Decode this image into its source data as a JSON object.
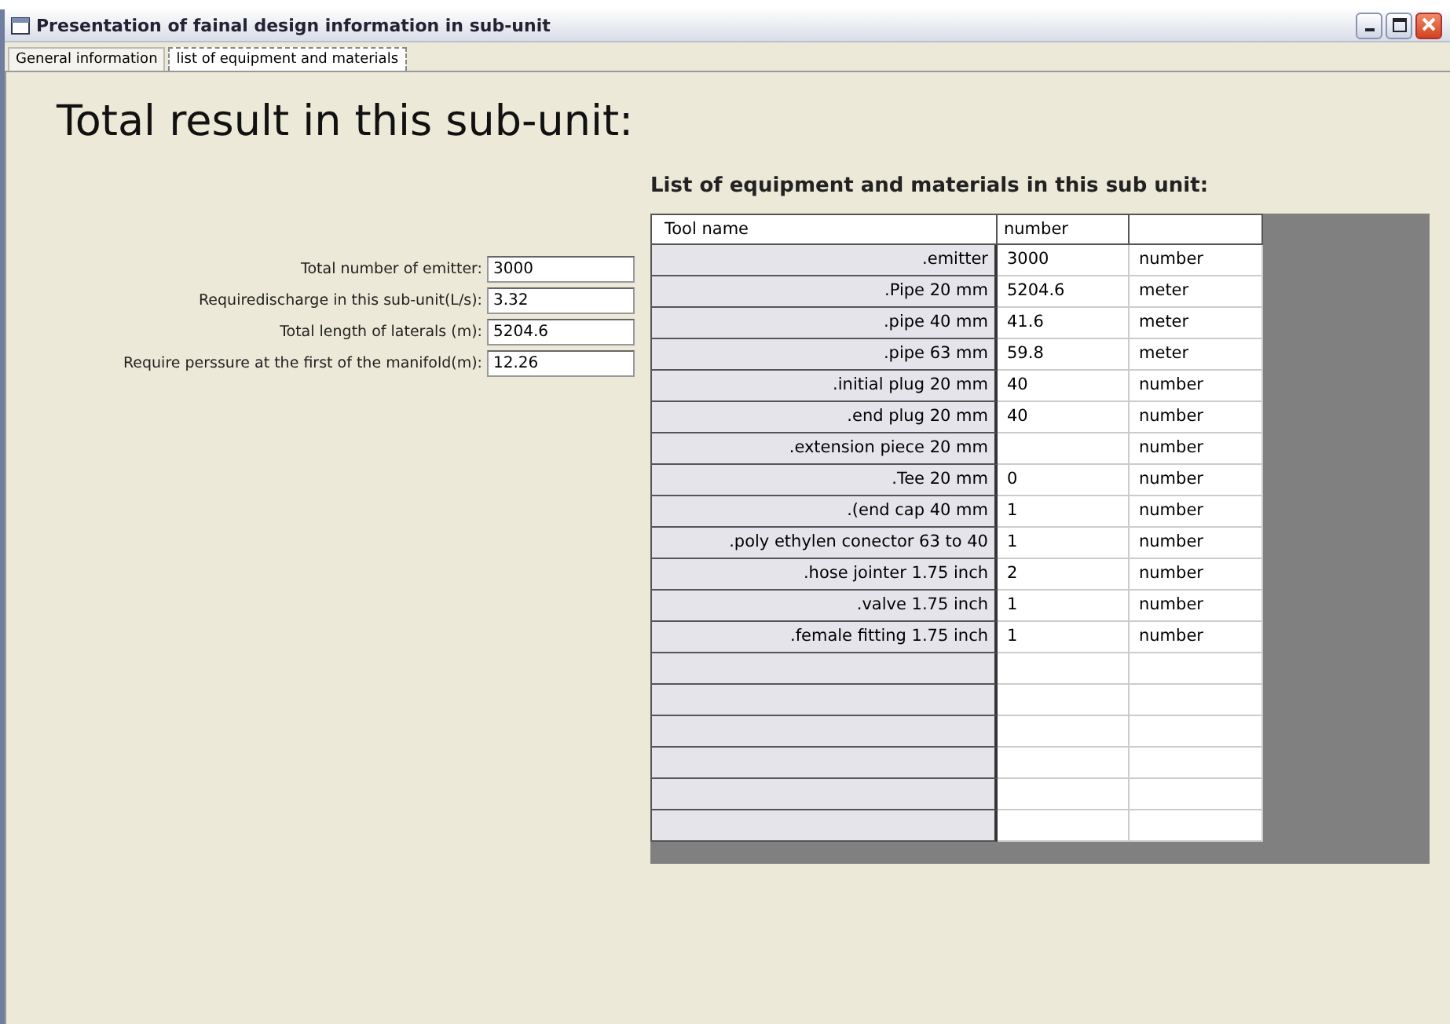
{
  "window": {
    "title": "Presentation of fainal design information in sub-unit"
  },
  "tabs": [
    {
      "label": "General information",
      "selected": false
    },
    {
      "label": "list of equipment and materials",
      "selected": true
    }
  ],
  "heading": "Total result in this sub-unit:",
  "fields": [
    {
      "label": "Total number of emitter:",
      "value": "3000"
    },
    {
      "label": "Requiredischarge in this sub-unit(L/s):",
      "value": "3.32"
    },
    {
      "label": "Total length of laterals (m):",
      "value": "5204.6"
    },
    {
      "label": "Require perssure at the first of the manifold(m):",
      "value": "12.26"
    }
  ],
  "table": {
    "title": "List of equipment and materials in this sub unit:",
    "columns": [
      "Tool name",
      "number"
    ],
    "rows": [
      {
        "name": ".emitter",
        "number": "3000",
        "unit": "number"
      },
      {
        "name": ".Pipe 20 mm",
        "number": "5204.6",
        "unit": "meter"
      },
      {
        "name": ".pipe 40 mm",
        "number": "41.6",
        "unit": "meter"
      },
      {
        "name": ".pipe 63 mm",
        "number": "59.8",
        "unit": "meter"
      },
      {
        "name": ".initial plug 20 mm",
        "number": "40",
        "unit": "number"
      },
      {
        "name": ".end plug 20 mm",
        "number": "40",
        "unit": "number"
      },
      {
        "name": ".extension piece 20 mm",
        "unit": "number"
      },
      {
        "name": ".Tee 20 mm",
        "number": "0",
        "unit": "number"
      },
      {
        "name": ".(end cap 40 mm",
        "number": "1",
        "unit": "number"
      },
      {
        "name": ".poly ethylen conector 63 to 40",
        "number": "1",
        "unit": "number"
      },
      {
        "name": ".hose jointer 1.75 inch",
        "number": "2",
        "unit": "number"
      },
      {
        "name": ".valve 1.75 inch",
        "number": "1",
        "unit": "number"
      },
      {
        "name": ".female fitting 1.75 inch",
        "number": "1",
        "unit": "number"
      }
    ]
  }
}
